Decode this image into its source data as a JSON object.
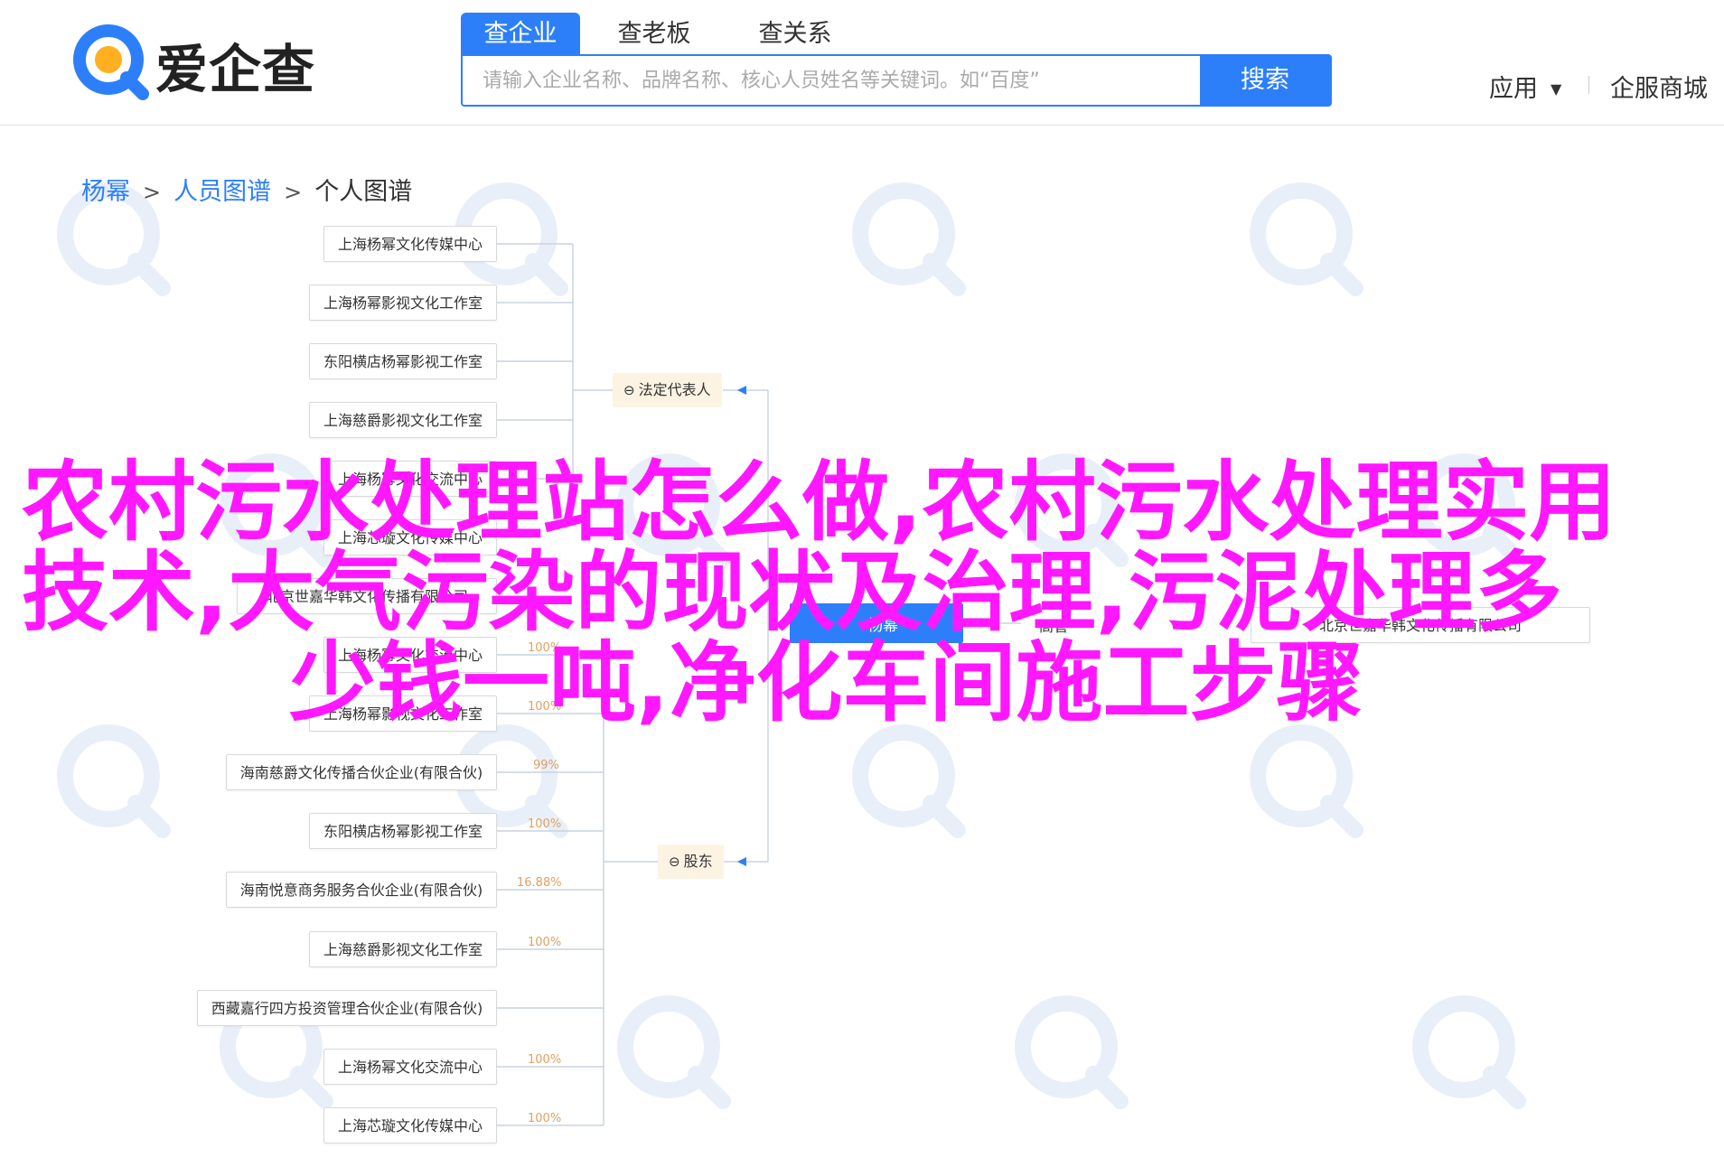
{
  "header": {
    "logo_text": "爱企查",
    "tabs": [
      {
        "label": "查企业",
        "active": true
      },
      {
        "label": "查老板",
        "active": false
      },
      {
        "label": "查关系",
        "active": false
      }
    ],
    "search": {
      "placeholder": "请输入企业名称、品牌名称、核心人员姓名等关键词。如“百度”",
      "button": "搜索"
    },
    "nav": {
      "app": "应用",
      "service": "企服商城"
    }
  },
  "breadcrumb": {
    "items": [
      "杨幂",
      "人员图谱"
    ],
    "current": "个人图谱"
  },
  "tree": {
    "legal_group": {
      "label": "法定代表人",
      "companies": [
        "上海杨幂文化传媒中心",
        "上海杨幂影视文化工作室",
        "东阳横店杨幂影视工作室",
        "上海慈爵影视文化工作室",
        "上海杨幂文化交流中心",
        "上海芯璇文化传媒中心"
      ]
    },
    "partial_rows": [
      {
        "company": "北京世嘉华韩文化传播有限公司"
      },
      {
        "company": "上海杨幂文化交流中心",
        "pct": "100%"
      },
      {
        "company": "上海杨幂影视文化工作室",
        "pct": "100%"
      }
    ],
    "shareholder_group": {
      "label": "股东",
      "companies": [
        {
          "name": "海南慈爵文化传播合伙企业(有限合伙)",
          "pct": "99%"
        },
        {
          "name": "东阳横店杨幂影视工作室",
          "pct": "100%"
        },
        {
          "name": "海南悦意商务服务合伙企业(有限合伙)",
          "pct": "16.88%"
        },
        {
          "name": "上海慈爵影视文化工作室",
          "pct": "100%"
        },
        {
          "name": "西藏嘉行四方投资管理合伙企业(有限合伙)",
          "pct": ""
        },
        {
          "name": "上海杨幂文化交流中心",
          "pct": "100%"
        },
        {
          "name": "上海芯璇文化传媒中心",
          "pct": "100%"
        }
      ]
    },
    "center": {
      "label": "杨幂"
    },
    "right": {
      "label": "高管",
      "company": "北京世嘉华韩文化传播有限公司"
    }
  },
  "headline": {
    "line1": "农村污水处理站怎么做,农村污水处理实用",
    "line2": "技术,大气污染的现状及治理,污泥处理多",
    "line3": "少钱一吨,净化车间施工步骤"
  },
  "colors": {
    "accent": "#2d7ff9",
    "headline": "#ff18ff",
    "group_bg": "#fcf3e3",
    "pct": "#e0a060"
  }
}
